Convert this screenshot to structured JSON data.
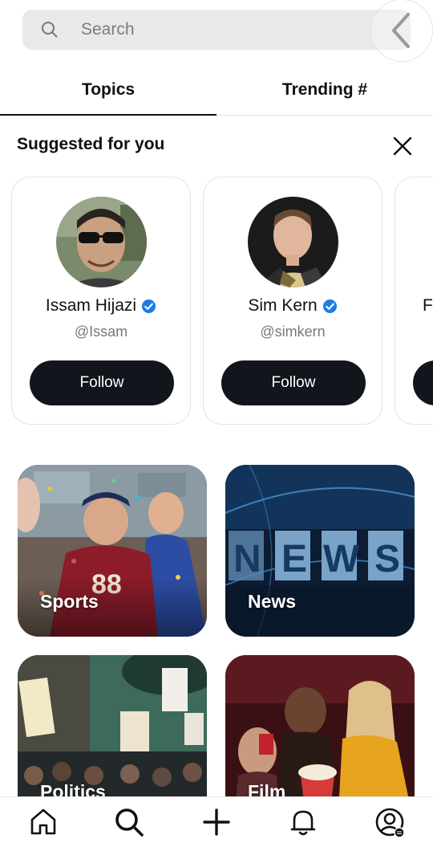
{
  "search": {
    "placeholder": "Search"
  },
  "tabs": [
    {
      "label": "Topics",
      "active": true
    },
    {
      "label": "Trending #",
      "active": false
    }
  ],
  "suggested": {
    "title": "Suggested for you",
    "cards": [
      {
        "name": "Issam Hijazi",
        "handle": "@Issam",
        "verified": true,
        "button": "Follow"
      },
      {
        "name": "Sim Kern",
        "handle": "@simkern",
        "verified": true,
        "button": "Follow"
      },
      {
        "name": "F",
        "handle": "",
        "verified": false,
        "button": ""
      }
    ]
  },
  "topics": [
    {
      "label": "Sports"
    },
    {
      "label": "News"
    },
    {
      "label": "Politics"
    },
    {
      "label": "Film"
    }
  ],
  "nav": [
    "home-icon",
    "search-icon",
    "plus-icon",
    "bell-icon",
    "profile-icon"
  ],
  "colors": {
    "follow_button": "#12151c",
    "verified": "#1d7de8",
    "search_bg": "#e9e9ea"
  }
}
